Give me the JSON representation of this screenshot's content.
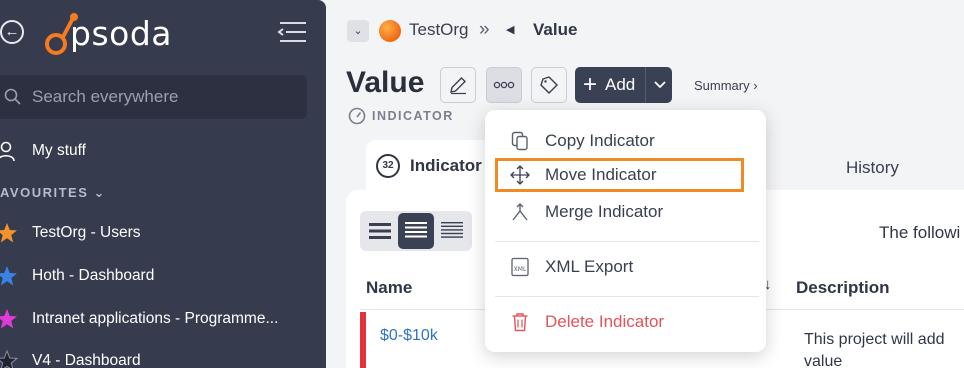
{
  "sidebar": {
    "logo_text": "psoda",
    "search_placeholder": "Search everywhere",
    "my_stuff": "My stuff",
    "favourites_header": "AVOURITES",
    "favourites": [
      {
        "label": "TestOrg - Users",
        "color": "#f2932b"
      },
      {
        "label": "Hoth - Dashboard",
        "color": "#3b82e6"
      },
      {
        "label": "Intranet applications - Programme...",
        "color": "#e03ad8"
      },
      {
        "label": "V4 - Dashboard",
        "color": "#2a2f3c"
      }
    ]
  },
  "breadcrumb": {
    "org": "TestOrg",
    "separator": "»",
    "current": "Value"
  },
  "header": {
    "title": "Value",
    "type_label": "INDICATOR",
    "add_label": "Add",
    "summary_link": "Summary ›"
  },
  "tabs": {
    "active_badge": "32",
    "active_label": "Indicator",
    "history_label": "History"
  },
  "content": {
    "intro_text": "The followi",
    "col_name": "Name",
    "col_sort_arrow": "↓",
    "col_description": "Description",
    "rows": [
      {
        "name": "$0-$10k",
        "description": "This project will add value"
      }
    ]
  },
  "dropdown": {
    "items": [
      {
        "label": "Copy Indicator",
        "icon": "copy-icon"
      },
      {
        "label": "Move Indicator",
        "icon": "move-icon"
      },
      {
        "label": "Merge Indicator",
        "icon": "merge-icon"
      },
      {
        "label": "XML Export",
        "icon": "xml-icon"
      },
      {
        "label": "Delete Indicator",
        "icon": "trash-icon"
      }
    ]
  },
  "colors": {
    "sidebar_bg": "#363b4d",
    "accent_orange": "#f08a24",
    "danger_red": "#e0545a",
    "link_blue": "#2f73c9",
    "button_dark": "#3a4154"
  }
}
